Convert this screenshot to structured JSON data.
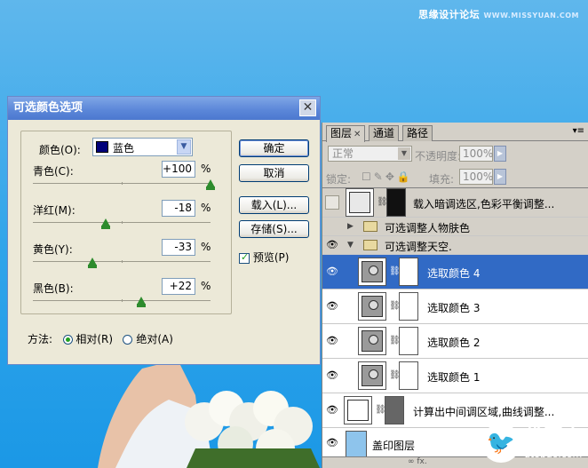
{
  "watermark": {
    "text": "思缘设计论坛",
    "site": "WWW.MISSYUAN.COM"
  },
  "dialog": {
    "title": "可选颜色选项",
    "color_label": "颜色(O):",
    "color_value": "蓝色",
    "swatch_color": "#00007a",
    "sliders": [
      {
        "label": "青色(C):",
        "value": "+100",
        "unit": "%",
        "level": 1.0
      },
      {
        "label": "洋红(M):",
        "value": "-18",
        "unit": "%",
        "level": 0.41
      },
      {
        "label": "黄色(Y):",
        "value": "-33",
        "unit": "%",
        "level": 0.335
      },
      {
        "label": "黑色(B):",
        "value": "+22",
        "unit": "%",
        "level": 0.61
      }
    ],
    "buttons": {
      "ok": "确定",
      "cancel": "取消",
      "load": "载入(L)...",
      "save": "存储(S)..."
    },
    "preview_label": "预览(P)",
    "method_label": "方法:",
    "method_relative": "相对(R)",
    "method_absolute": "绝对(A)"
  },
  "layers_panel": {
    "tabs": [
      "图层",
      "通道",
      "路径"
    ],
    "blend_mode": "正常",
    "opacity_label": "不透明度:",
    "opacity_value": "100%",
    "lock_label": "锁定:",
    "fill_label": "填充:",
    "fill_value": "100%",
    "layers": [
      {
        "name": "载入暗调选区,色彩平衡调整..."
      },
      {
        "name": "可选调整人物肤色"
      },
      {
        "name": "可选调整天空."
      },
      {
        "name": "选取颜色 4"
      },
      {
        "name": "选取颜色 3"
      },
      {
        "name": "选取颜色 2"
      },
      {
        "name": "选取颜色 1"
      },
      {
        "name": "计算出中间调区域,曲线调整..."
      },
      {
        "name": "盖印图层"
      }
    ],
    "bottom_icons": "∞  fx."
  },
  "logo": {
    "cn": "优图宝",
    "en": "utobao.com"
  }
}
